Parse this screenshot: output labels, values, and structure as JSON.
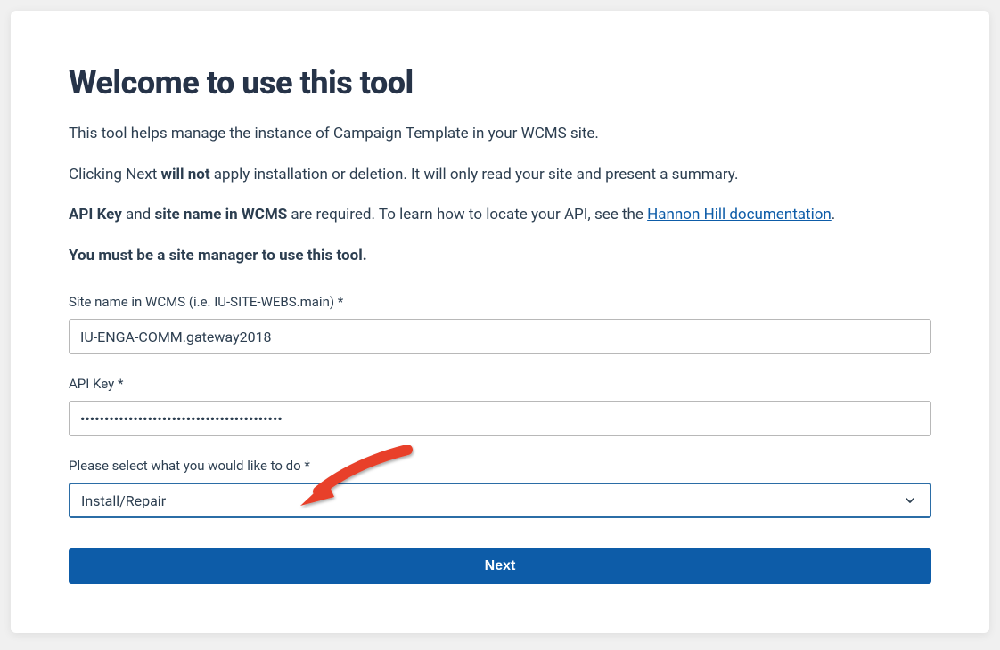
{
  "title": "Welcome to use this tool",
  "intro": {
    "line1": "This tool helps manage the instance of Campaign Template in your WCMS site.",
    "line2_prefix": "Clicking Next ",
    "line2_bold": "will not",
    "line2_suffix": " apply installation or deletion. It will only read your site and present a summary.",
    "line3_bold1": "API Key",
    "line3_mid1": " and ",
    "line3_bold2": "site name in WCMS",
    "line3_mid2": " are required. To learn how to locate your API, see the ",
    "line3_link": "Hannon Hill documentation",
    "line3_suffix": ".",
    "line4_bold": "You must be a site manager to use this tool."
  },
  "form": {
    "siteName": {
      "label": "Site name in WCMS (i.e. IU-SITE-WEBS.main) *",
      "value": "IU-ENGA-COMM.gateway2018"
    },
    "apiKey": {
      "label": "API Key *",
      "value": "••••••••••••••••••••••••••••••••••••••••••"
    },
    "action": {
      "label": "Please select what you would like to do *",
      "selected": "Install/Repair"
    },
    "submitLabel": "Next"
  }
}
